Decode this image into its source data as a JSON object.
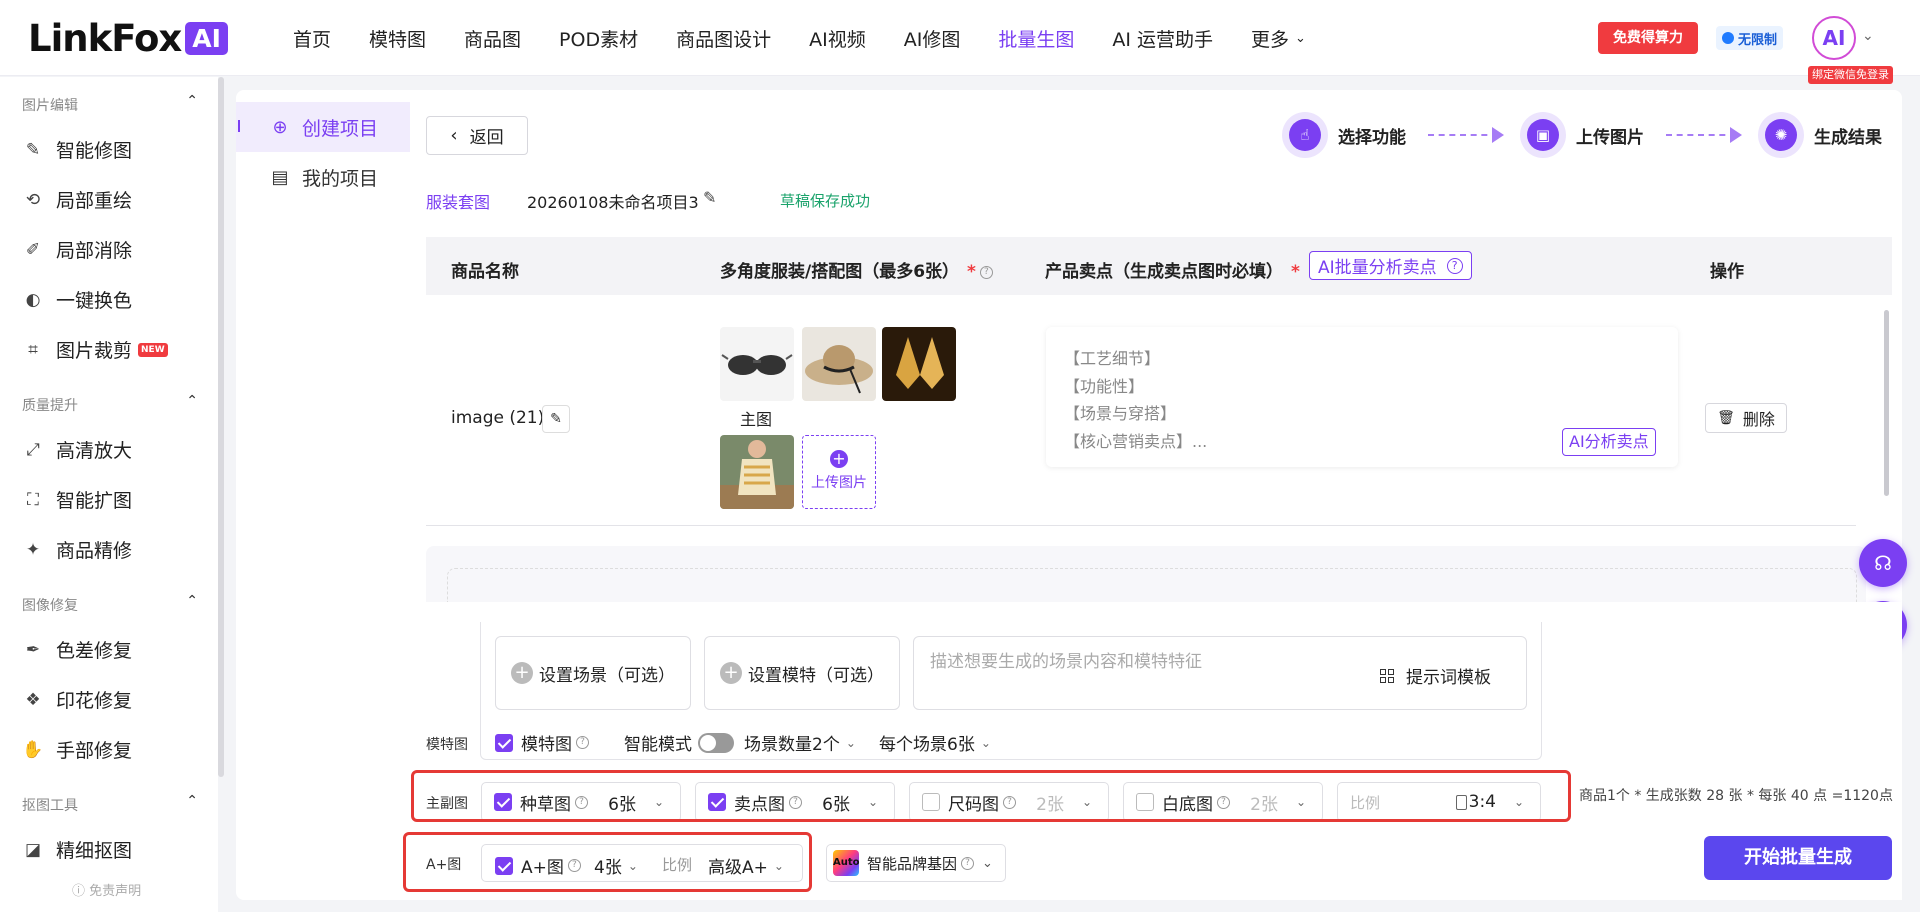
{
  "brand": {
    "logo_text": "LinkFox",
    "logo_ai": "AI"
  },
  "nav": {
    "items": [
      "首页",
      "模特图",
      "商品图",
      "POD素材",
      "商品图设计",
      "AI视频",
      "AI修图",
      "批量生图",
      "AI 运营助手"
    ],
    "more": "更多",
    "active": "批量生图"
  },
  "header": {
    "free_button": "免费得算力",
    "unlimited": "无限制",
    "avatar_text": "AI",
    "bind_wechat": "绑定微信免登录"
  },
  "sidebar": {
    "groups": [
      {
        "title": "图片编辑",
        "items": [
          "智能修图",
          "局部重绘",
          "局部消除",
          "一键换色",
          "图片裁剪"
        ]
      },
      {
        "title": "质量提升",
        "items": [
          "高清放大",
          "智能扩图",
          "商品精修"
        ]
      },
      {
        "title": "图像修复",
        "items": [
          "色差修复",
          "印花修复",
          "手部修复"
        ]
      },
      {
        "title": "抠图工具",
        "items": [
          "精细抠图"
        ]
      }
    ],
    "new_badge": "NEW",
    "disclaimer": "免责声明"
  },
  "subnav": {
    "create": "创建项目",
    "mine": "我的项目"
  },
  "toolbar": {
    "back": "返回"
  },
  "steps": [
    "选择功能",
    "上传图片",
    "生成结果"
  ],
  "project": {
    "type": "服装套图",
    "name": "20260108未命名项目3",
    "saved": "草稿保存成功"
  },
  "table": {
    "headers": {
      "name": "商品名称",
      "images": "多角度服装/搭配图（最多6张）",
      "points": "产品卖点（生成卖点图时必填）",
      "ai_batch": "AI批量分析卖点",
      "ops": "操作"
    },
    "row": {
      "name": "image (21)",
      "main_label": "主图",
      "upload": "上传图片",
      "points": [
        "【工艺细节】",
        "【功能性】",
        "【场景与穿搭】",
        "【核心营销卖点】..."
      ],
      "ai_analyze": "AI分析卖点",
      "delete": "删除"
    }
  },
  "model_section": {
    "scene": "设置场景（可选）",
    "model": "设置模特（可选）",
    "desc_placeholder": "描述想要生成的场景内容和模特特征",
    "template": "提示词模板",
    "row_label": "模特图",
    "checkbox": "模特图",
    "smart_mode": "智能模式",
    "scene_count": "场景数量2个",
    "per_scene": "每个场景6张"
  },
  "main_section": {
    "row_label": "主副图",
    "options": [
      {
        "label": "种草图",
        "count": "6张",
        "checked": true
      },
      {
        "label": "卖点图",
        "count": "6张",
        "checked": true
      },
      {
        "label": "尺码图",
        "count": "2张",
        "checked": false
      },
      {
        "label": "白底图",
        "count": "2张",
        "checked": false
      }
    ],
    "ratio_label": "比例",
    "ratio_value": "3:4",
    "calc": "商品1个 * 生成张数 28 张 * 每张 40 点 =1120点"
  },
  "aplus_section": {
    "row_label": "A+图",
    "checkbox": "A+图",
    "count": "4张",
    "ratio_label": "比例",
    "ratio_value": "高级A+",
    "brand_label": "智能品牌基因",
    "auto": "Auto"
  },
  "start_button": "开始批量生成",
  "colors": {
    "accent": "#7b3ff2",
    "danger": "#f03b3f",
    "success": "#1aa36b",
    "primary_button": "#5b47ee"
  }
}
